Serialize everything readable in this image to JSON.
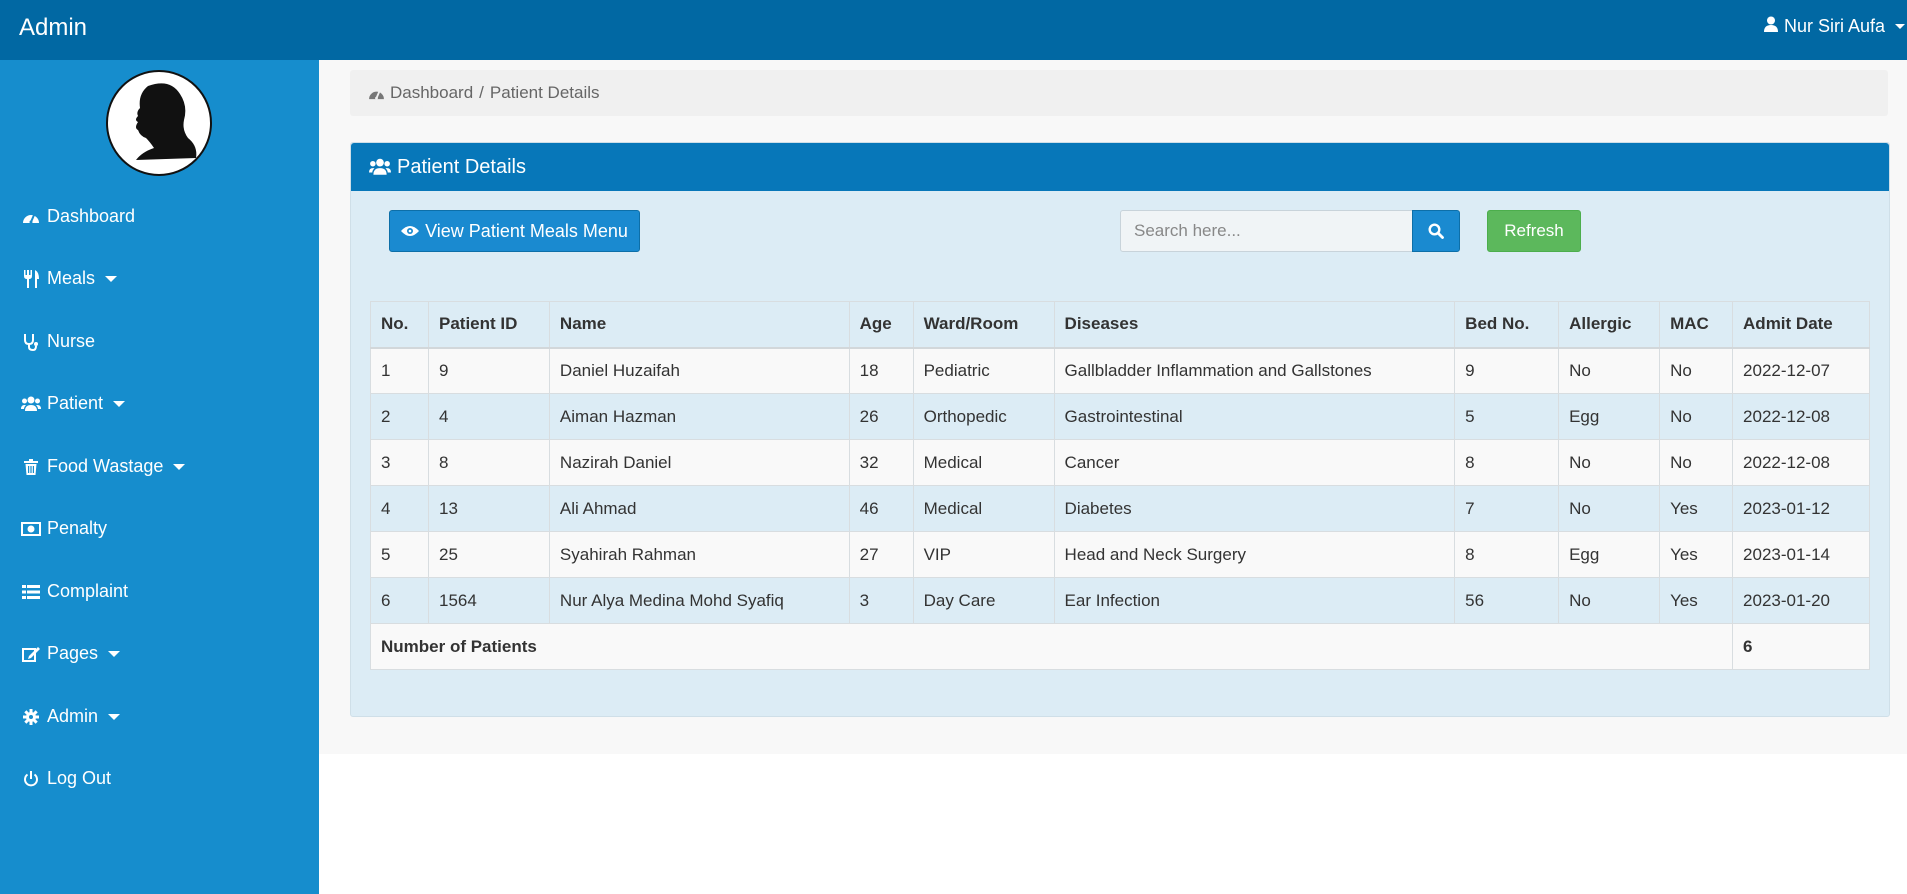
{
  "topbar": {
    "brand": "Admin",
    "user_name": "Nur Siri Aufa"
  },
  "sidebar": {
    "items": [
      {
        "label": "Dashboard",
        "icon": "dashboard-icon"
      },
      {
        "label": "Meals",
        "icon": "cutlery-icon"
      },
      {
        "label": "Nurse",
        "icon": "stethoscope-icon"
      },
      {
        "label": "Patient",
        "icon": "users-icon"
      },
      {
        "label": "Food Wastage",
        "icon": "trash-icon"
      },
      {
        "label": "Penalty",
        "icon": "money-icon"
      },
      {
        "label": "Complaint",
        "icon": "list-icon"
      },
      {
        "label": "Pages",
        "icon": "edit-icon"
      },
      {
        "label": "Admin",
        "icon": "gear-icon"
      },
      {
        "label": "Log Out",
        "icon": "power-icon"
      }
    ]
  },
  "breadcrumb": {
    "root": "Dashboard",
    "separator": "/",
    "current": "Patient Details"
  },
  "panel": {
    "title": "Patient Details",
    "view_button": "View Patient Meals Menu",
    "search_placeholder": "Search here...",
    "refresh_button": "Refresh"
  },
  "table": {
    "headers": [
      "No.",
      "Patient ID",
      "Name",
      "Age",
      "Ward/Room",
      "Diseases",
      "Bed No.",
      "Allergic",
      "MAC",
      "Admit Date"
    ],
    "rows": [
      [
        "1",
        "9",
        "Daniel Huzaifah",
        "18",
        "Pediatric",
        "Gallbladder Inflammation and Gallstones",
        "9",
        "No",
        "No",
        "2022-12-07"
      ],
      [
        "2",
        "4",
        "Aiman Hazman",
        "26",
        "Orthopedic",
        "Gastrointestinal",
        "5",
        "Egg",
        "No",
        "2022-12-08"
      ],
      [
        "3",
        "8",
        "Nazirah Daniel",
        "32",
        "Medical",
        "Cancer",
        "8",
        "No",
        "No",
        "2022-12-08"
      ],
      [
        "4",
        "13",
        "Ali Ahmad",
        "46",
        "Medical",
        "Diabetes",
        "7",
        "No",
        "Yes",
        "2023-01-12"
      ],
      [
        "5",
        "25",
        "Syahirah Rahman",
        "27",
        "VIP",
        "Head and Neck Surgery",
        "8",
        "Egg",
        "Yes",
        "2023-01-14"
      ],
      [
        "6",
        "1564",
        "Nur Alya Medina Mohd Syafiq",
        "3",
        "Day Care",
        "Ear Infection",
        "56",
        "No",
        "Yes",
        "2023-01-20"
      ]
    ],
    "footer_label": "Number of Patients",
    "footer_count": "6"
  },
  "colors": {
    "topbar": "#0168a3",
    "sidebar": "#168dcd",
    "panel_header": "#0777b9",
    "refresh": "#5cb85c"
  }
}
